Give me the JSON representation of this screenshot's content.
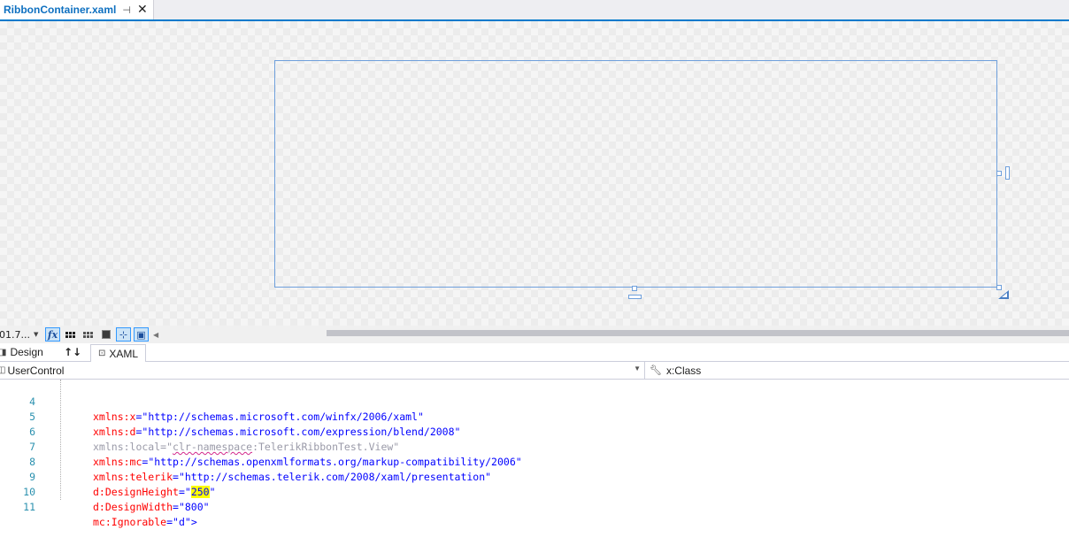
{
  "tab": {
    "title": "RibbonContainer.xaml",
    "pin_icon": "pin-icon",
    "close_icon": "close-icon"
  },
  "toolbar": {
    "zoom_value": "01.7...",
    "buttons": [
      "fx-toggle",
      "grid-lines",
      "snap-gridlines",
      "artboard-background",
      "snap-to-snaplines",
      "device-preview"
    ]
  },
  "view_tabs": {
    "design_label": "Design",
    "swap_glyph": "↑↓",
    "xaml_label": "XAML"
  },
  "navbar": {
    "element": "UserControl",
    "member": "x:Class"
  },
  "editor": {
    "lines": [
      {
        "num": "4",
        "attr": "xmlns:x",
        "value": "\"http://schemas.microsoft.com/winfx/2006/xaml\""
      },
      {
        "num": "5",
        "attr": "xmlns:d",
        "value": "\"http://schemas.microsoft.com/expression/blend/2008\""
      },
      {
        "num": "6",
        "attr": "xmlns:local",
        "value_pre": "\"",
        "value_squiggle": "clr-namespace",
        "value_post": ":TelerikRibbonTest.View\""
      },
      {
        "num": "7",
        "attr": "xmlns:mc",
        "value": "\"http://schemas.openxmlformats.org/markup-compatibility/2006\""
      },
      {
        "num": "8",
        "attr": "xmlns:telerik",
        "value": "\"http://schemas.telerik.com/2008/xaml/presentation\""
      },
      {
        "num": "9",
        "attr": "d:DesignHeight",
        "value_pre": "\"",
        "value_hl": "250",
        "value_post": "\""
      },
      {
        "num": "10",
        "attr": "d:DesignWidth",
        "value": "\"800\""
      },
      {
        "num": "11",
        "attr": "mc:Ignorable",
        "value": "\"d\"",
        "tail": ">"
      }
    ]
  },
  "colors": {
    "tab_accent": "#007acc",
    "tab_title": "#0e70c0",
    "artboard_border": "#6fa0dc",
    "line_number": "#2b91af",
    "xml_attribute": "#ff0000",
    "xml_value": "#0000ff",
    "highlight": "#ffff00"
  }
}
